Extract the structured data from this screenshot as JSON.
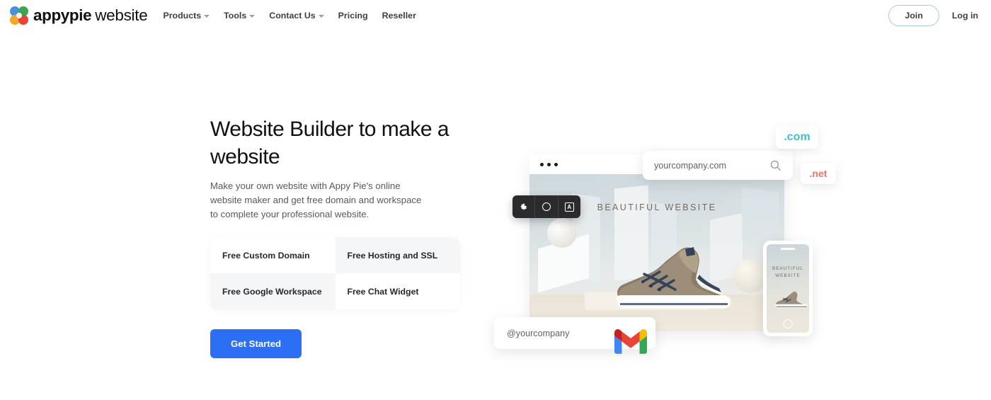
{
  "header": {
    "brand_name": "appypie",
    "brand_suffix": "website",
    "logo_icon": "appypie-flower-logo",
    "nav": [
      {
        "label": "Products",
        "has_caret": true
      },
      {
        "label": "Tools",
        "has_caret": true
      },
      {
        "label": "Contact Us",
        "has_caret": true
      },
      {
        "label": "Pricing",
        "has_caret": false
      },
      {
        "label": "Reseller",
        "has_caret": false
      }
    ],
    "join_label": "Join",
    "login_label": "Log in"
  },
  "hero": {
    "headline": "Website Builder to make a website",
    "subcopy": "Make your own website with Appy Pie's online website maker and get free domain and workspace to complete your professional website.",
    "cta_label": "Get Started",
    "features": [
      "Free Custom Domain",
      "Free Hosting and SSL",
      "Free Google Workspace",
      "Free Chat Widget"
    ]
  },
  "illustration": {
    "browser_title": "BEAUTIFUL WEBSITE",
    "search_value": "yourcompany.com",
    "search_icon": "magnifier-icon",
    "toolbar_icons": [
      "gear-icon",
      "circle-icon",
      "text-box-icon"
    ],
    "chip_com": ".com",
    "chip_net": ".net",
    "phone_title": "BEAUTIFUL WEBSITE",
    "handle_value": "@yourcompany",
    "gmail_icon": "gmail-logo",
    "window_dots": 3
  },
  "colors": {
    "cta_blue": "#2c6ef5",
    "join_border": "#a9c7f5",
    "chip_com": "#3fc0c9",
    "chip_net": "#f9705f",
    "logo_blue": "#4a90e2",
    "logo_green": "#34a853",
    "logo_orange": "#f5a623",
    "logo_red": "#ea4335"
  }
}
